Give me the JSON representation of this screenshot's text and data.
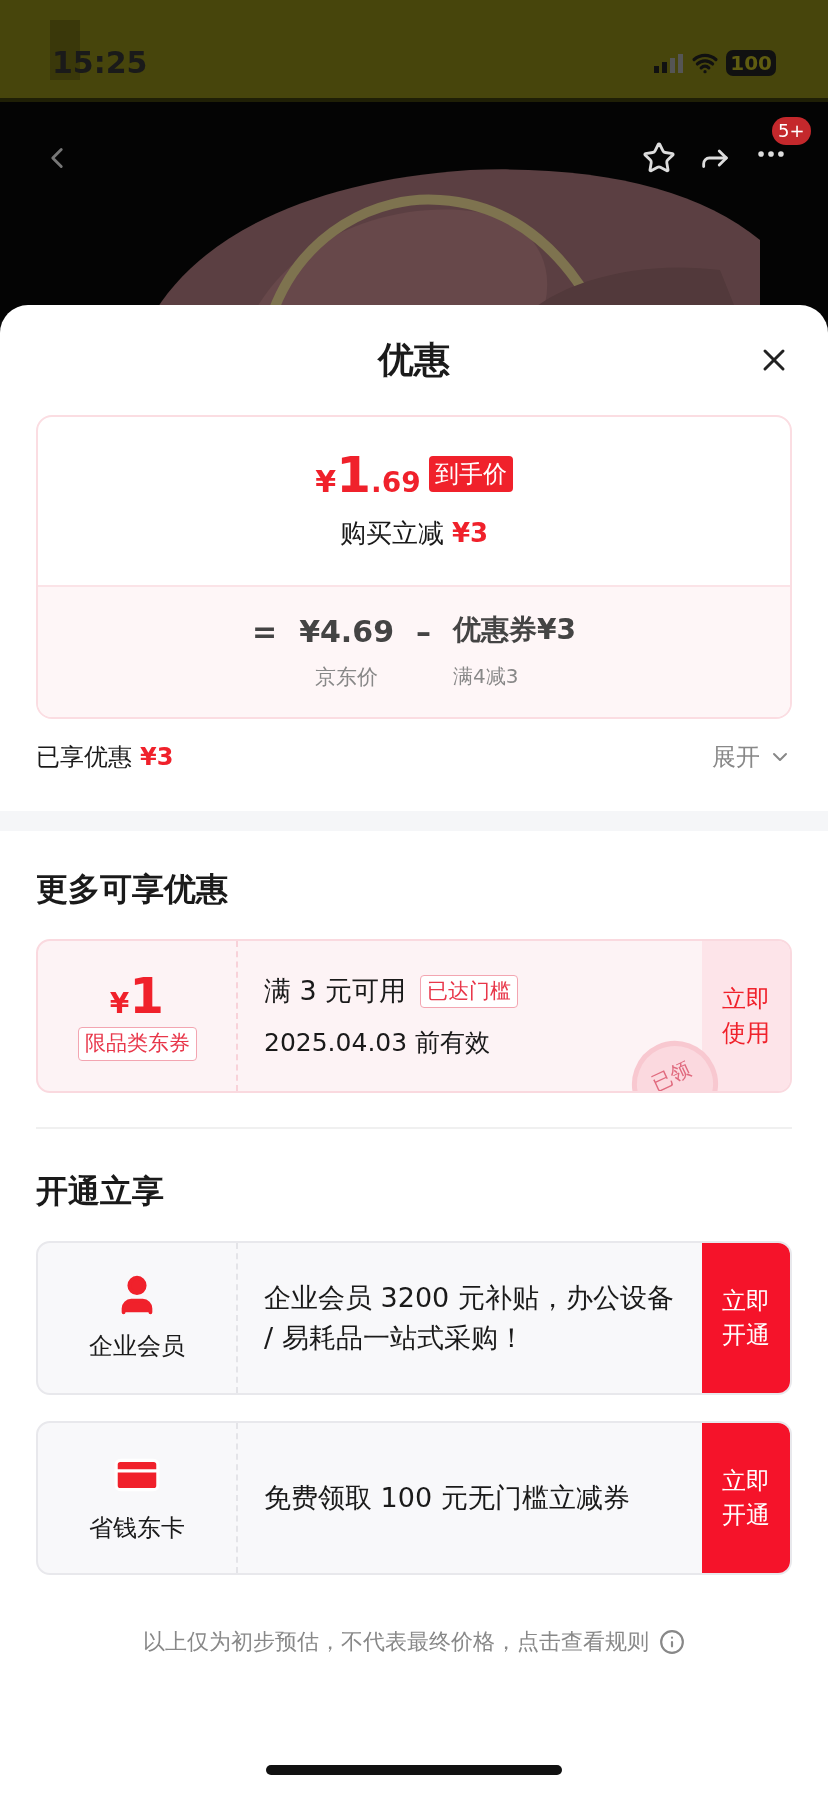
{
  "status_bar": {
    "time": "15:25",
    "battery": "100"
  },
  "header": {
    "badge": "5+"
  },
  "sheet": {
    "title": "优惠"
  },
  "price_card": {
    "currency": "¥",
    "price_int": "1",
    "price_dec": ".69",
    "tag": "到手价",
    "instant_label": "购买立减",
    "instant_amount": "¥3",
    "equals": "=",
    "base": "¥4.69",
    "base_label": "京东价",
    "minus": "–",
    "coupon": "优惠券¥3",
    "coupon_label": "满4减3"
  },
  "enjoyed": {
    "label": "已享优惠",
    "amount": "¥3",
    "expand": "展开",
    "expanded": false
  },
  "more_section": {
    "title": "更多可享优惠",
    "coupons": [
      {
        "currency": "¥",
        "amount": "1",
        "scope": "限品类东券",
        "condition": "满 3 元可用",
        "badge": "已达门槛",
        "validity": "2025.04.03 前有效",
        "stamp": "已领",
        "action_lines": [
          "立即",
          "使用"
        ]
      }
    ]
  },
  "open_section": {
    "title": "开通立享",
    "offers": [
      {
        "kind": "member",
        "name": "企业会员",
        "text": "企业会员 3200 元补贴，办公设备 / 易耗品一站式采购！",
        "action_lines": [
          "立即",
          "开通"
        ]
      },
      {
        "kind": "card",
        "name": "省钱东卡",
        "text": "免费领取 100 元无门槛立减券",
        "action_lines": [
          "立即",
          "开通"
        ]
      }
    ]
  },
  "footer": {
    "text": "以上仅为初步预估，不代表最终价格，点击查看规则"
  }
}
